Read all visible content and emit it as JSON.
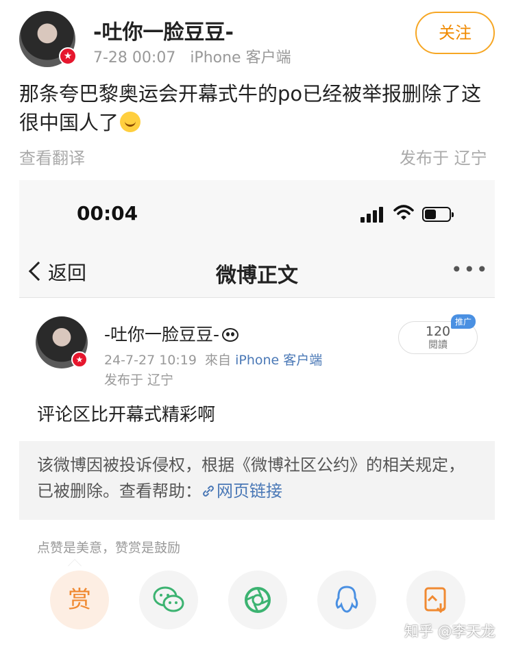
{
  "post": {
    "author": "-吐你一脸豆豆-",
    "time": "7-28 00:07",
    "client": "iPhone 客户端",
    "follow_label": "关注",
    "text": "那条夸巴黎奥运会开幕式牛的po已经被举报删除了这很中国人了",
    "translate_label": "查看翻译",
    "location": "发布于 辽宁"
  },
  "screenshot": {
    "status_time": "00:04",
    "nav": {
      "back_label": "返回",
      "title": "微博正文",
      "more": "•••"
    },
    "inner": {
      "author": "-吐你一脸豆豆-",
      "time": "24-7-27 10:19",
      "from_label": "來自",
      "client": "iPhone 客户端",
      "location": "发布于 辽宁",
      "reads": "120",
      "reads_label": "閱讀",
      "promo": "推广",
      "text": "评论区比开幕式精彩啊"
    },
    "notice": {
      "text": "该微博因被投诉侵权，根据《微博社区公约》的相关规定，已被删除。查看帮助：",
      "link": "网页链接"
    },
    "reward_hint": "点赞是美意，赞赏是鼓励",
    "reward_label": "赏",
    "share_icons": [
      "reward-icon",
      "wechat-icon",
      "moments-icon",
      "qq-icon",
      "save-image-icon"
    ]
  },
  "watermark": "知乎 @李天龙",
  "colors": {
    "accent": "#f08a00",
    "link": "#4a78b6",
    "verified": "#e6162d",
    "reward": "#f08a32",
    "wechat": "#3cb371",
    "qq": "#4a90e2"
  }
}
